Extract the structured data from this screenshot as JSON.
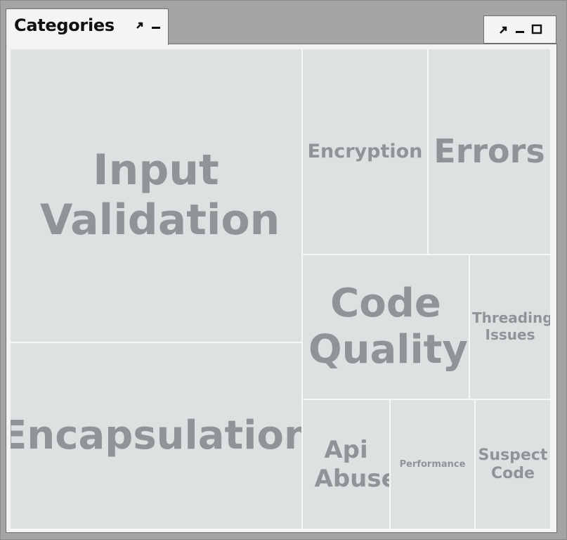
{
  "tab": {
    "title": "Categories"
  },
  "icons": {
    "tab_restore": "restore-arrow-icon",
    "tab_minimize": "minimize-icon",
    "win_restore": "restore-arrow-icon",
    "win_minimize": "minimize-icon",
    "win_maximize": "maximize-icon"
  },
  "colors": {
    "cell_bg": "#dde1e2",
    "cell_text": "#8f9596",
    "cell_border": "#f6f8f8"
  },
  "treemap": {
    "categories": [
      {
        "label": "Input Validation"
      },
      {
        "label": "Encapsulation"
      },
      {
        "label": "Encryption"
      },
      {
        "label": "Errors"
      },
      {
        "label": "Code Quality"
      },
      {
        "label": "Threading Issues"
      },
      {
        "label": "Api Abuse"
      },
      {
        "label": "Performance"
      },
      {
        "label": "Suspect Code"
      }
    ]
  }
}
